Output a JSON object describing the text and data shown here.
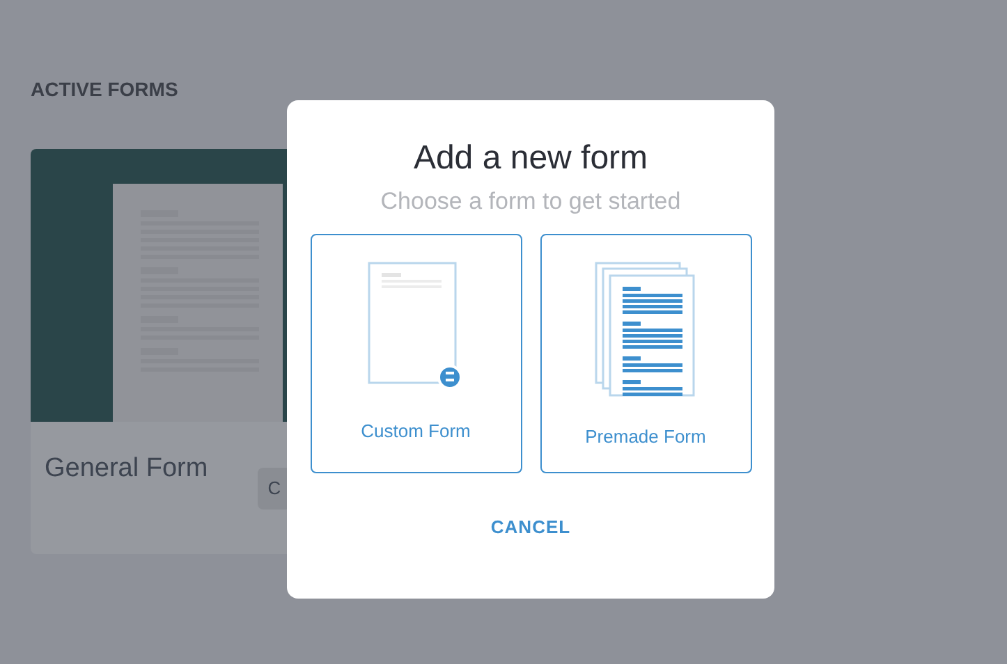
{
  "page": {
    "section_title": "ACTIVE FORMS",
    "forms": [
      {
        "title": "General Form",
        "button": "C"
      }
    ]
  },
  "dialog": {
    "title": "Add a new form",
    "subtitle": "Choose a form to get started",
    "options": [
      {
        "kind": "custom",
        "label": "Custom Form"
      },
      {
        "kind": "premade",
        "label": "Premade Form"
      }
    ],
    "cancel": "CANCEL"
  }
}
